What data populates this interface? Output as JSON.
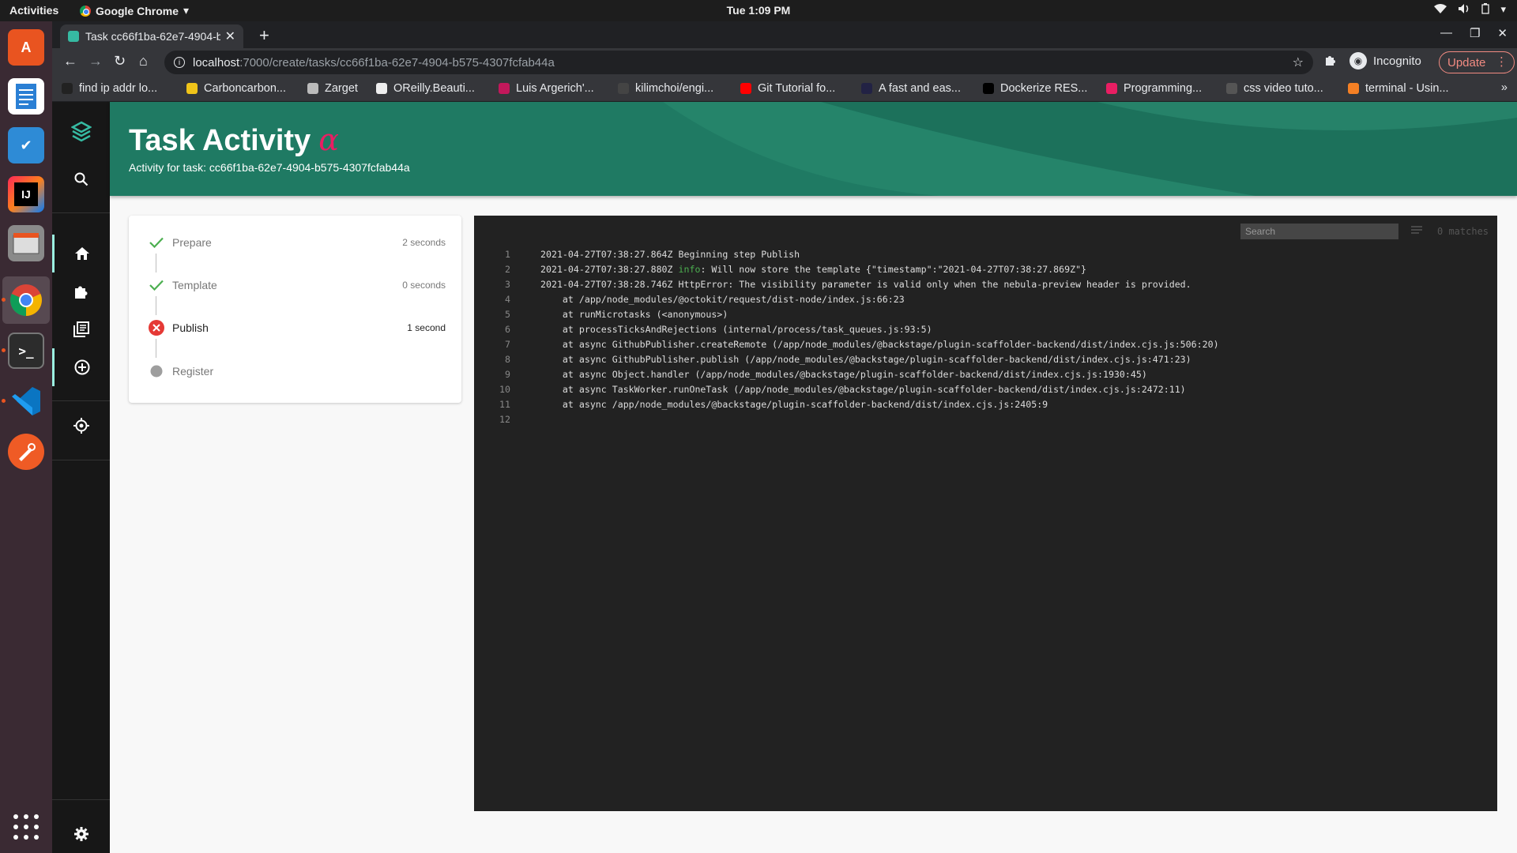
{
  "topbar": {
    "activities": "Activities",
    "app_name": "Google Chrome",
    "clock": "Tue  1:09 PM"
  },
  "browser": {
    "tab_title": "Task cc66f1ba-62e7-4904-b",
    "url_host": "localhost",
    "url_path": ":7000/create/tasks/cc66f1ba-62e7-4904-b575-4307fcfab44a",
    "profile_label": "Incognito",
    "update_label": "Update",
    "bookmarks": [
      {
        "label": "find ip addr lo...",
        "color": "#222222"
      },
      {
        "label": "Carboncarbon...",
        "color": "#f0c419"
      },
      {
        "label": "Zarget",
        "color": "#bbbbbb"
      },
      {
        "label": "OReilly.Beauti...",
        "color": "#eeeeee"
      },
      {
        "label": "Luis Argerich'...",
        "color": "#c2185b"
      },
      {
        "label": "kilimchoi/engi...",
        "color": "#444444"
      },
      {
        "label": "Git Tutorial fo...",
        "color": "#ff0000"
      },
      {
        "label": "A fast and eas...",
        "color": "#222244"
      },
      {
        "label": "Dockerize RES...",
        "color": "#000000"
      },
      {
        "label": "Programming...",
        "color": "#e91e63"
      },
      {
        "label": "css video tuto...",
        "color": "#555555"
      },
      {
        "label": "terminal - Usin...",
        "color": "#f48024"
      }
    ]
  },
  "header": {
    "title": "Task Activity",
    "alpha": "α",
    "subtitle": "Activity for task: cc66f1ba-62e7-4904-b575-4307fcfab44a"
  },
  "steps": [
    {
      "label": "Prepare",
      "time": "2 seconds",
      "status": "done"
    },
    {
      "label": "Template",
      "time": "0 seconds",
      "status": "done"
    },
    {
      "label": "Publish",
      "time": "1 second",
      "status": "failed"
    },
    {
      "label": "Register",
      "time": "",
      "status": "pending"
    }
  ],
  "log": {
    "search_placeholder": "Search",
    "matches": "0 matches",
    "lines": [
      {
        "num": "1",
        "pre": "2021-04-27T07:38:27.864Z Beginning step Publish",
        "tag": "",
        "post": ""
      },
      {
        "num": "2",
        "pre": "2021-04-27T07:38:27.880Z ",
        "tag": "info",
        "post": ": Will now store the template {\"timestamp\":\"2021-04-27T07:38:27.869Z\"}"
      },
      {
        "num": "3",
        "pre": "2021-04-27T07:38:28.746Z HttpError: The visibility parameter is valid only when the nebula-preview header is provided.",
        "tag": "",
        "post": ""
      },
      {
        "num": "4",
        "pre": "    at /app/node_modules/@octokit/request/dist-node/index.js:66:23",
        "tag": "",
        "post": ""
      },
      {
        "num": "5",
        "pre": "    at runMicrotasks (<anonymous>)",
        "tag": "",
        "post": ""
      },
      {
        "num": "6",
        "pre": "    at processTicksAndRejections (internal/process/task_queues.js:93:5)",
        "tag": "",
        "post": ""
      },
      {
        "num": "7",
        "pre": "    at async GithubPublisher.createRemote (/app/node_modules/@backstage/plugin-scaffolder-backend/dist/index.cjs.js:506:20)",
        "tag": "",
        "post": ""
      },
      {
        "num": "8",
        "pre": "    at async GithubPublisher.publish (/app/node_modules/@backstage/plugin-scaffolder-backend/dist/index.cjs.js:471:23)",
        "tag": "",
        "post": ""
      },
      {
        "num": "9",
        "pre": "    at async Object.handler (/app/node_modules/@backstage/plugin-scaffolder-backend/dist/index.cjs.js:1930:45)",
        "tag": "",
        "post": ""
      },
      {
        "num": "10",
        "pre": "    at async TaskWorker.runOneTask (/app/node_modules/@backstage/plugin-scaffolder-backend/dist/index.cjs.js:2472:11)",
        "tag": "",
        "post": ""
      },
      {
        "num": "11",
        "pre": "    at async /app/node_modules/@backstage/plugin-scaffolder-backend/dist/index.cjs.js:2405:9",
        "tag": "",
        "post": ""
      },
      {
        "num": "12",
        "pre": "",
        "tag": "",
        "post": ""
      }
    ]
  },
  "colors": {
    "header_bg": "#1f7a63",
    "nav_bg": "#171717",
    "nav_active": "#9bf0e1",
    "success": "#4caf50",
    "error": "#e53935",
    "log_bg": "#222222"
  }
}
